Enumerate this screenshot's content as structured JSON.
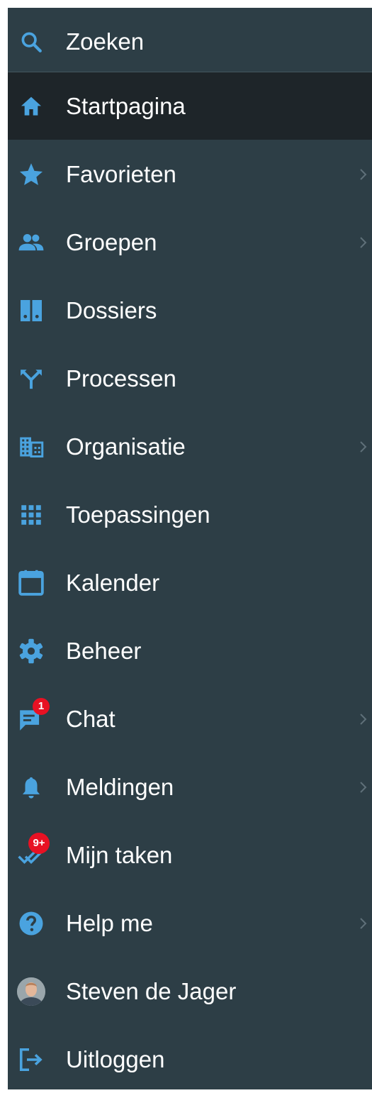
{
  "nav": {
    "search_label": "Zoeken",
    "items": [
      {
        "label": "Startpagina"
      },
      {
        "label": "Favorieten"
      },
      {
        "label": "Groepen"
      },
      {
        "label": "Dossiers"
      },
      {
        "label": "Processen"
      },
      {
        "label": "Organisatie"
      },
      {
        "label": "Toepassingen"
      },
      {
        "label": "Kalender"
      },
      {
        "label": "Beheer"
      },
      {
        "label": "Chat",
        "badge": "1"
      },
      {
        "label": "Meldingen"
      },
      {
        "label": "Mijn taken",
        "badge": "9+"
      },
      {
        "label": "Help me"
      },
      {
        "label": "Steven de Jager"
      },
      {
        "label": "Uitloggen"
      }
    ]
  },
  "colors": {
    "sidebar_bg": "#2d3e46",
    "active_bg": "#1e2529",
    "icon_accent": "#4aa3df",
    "badge": "#e81123",
    "text": "#ffffff",
    "chevron": "#5f7079"
  }
}
